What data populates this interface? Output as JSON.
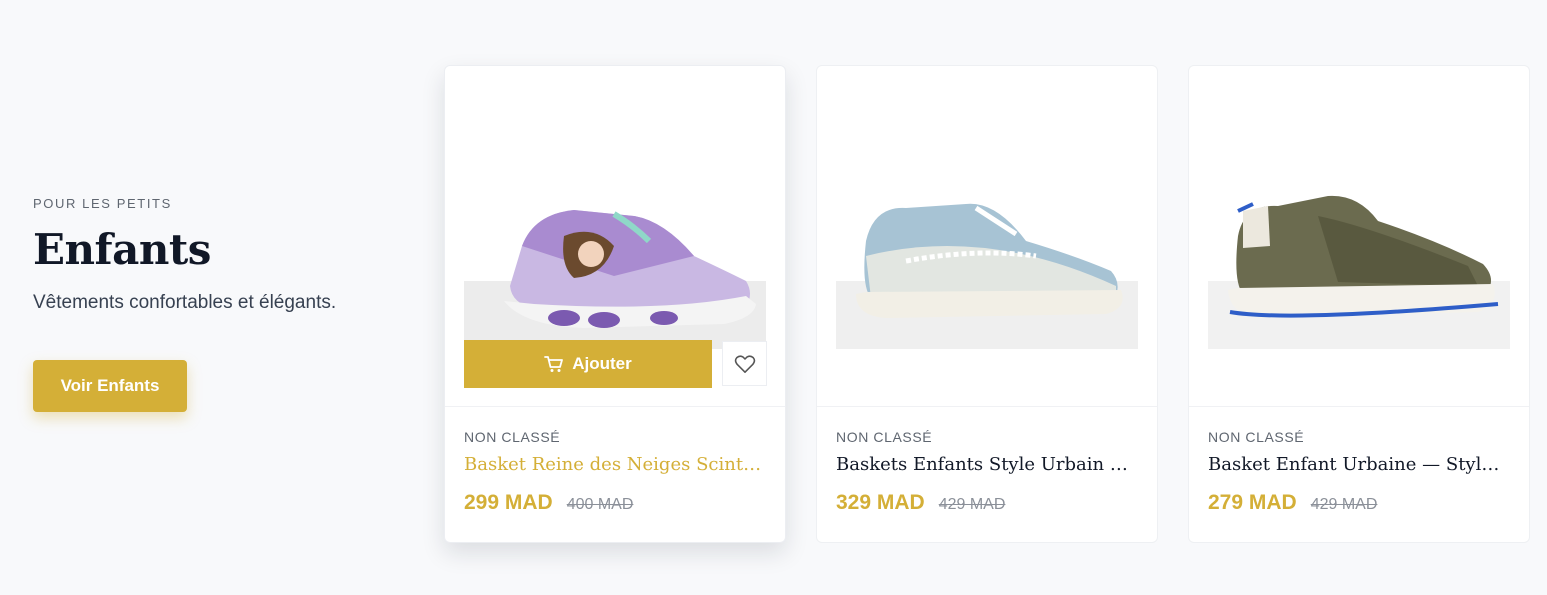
{
  "section": {
    "eyebrow": "POUR LES PETITS",
    "title": "Enfants",
    "subtitle": "Vêtements confortables et élégants.",
    "cta_label": "Voir Enfants"
  },
  "colors": {
    "accent": "#d4af37",
    "text_dark": "#111827",
    "muted": "#5f6670"
  },
  "products": [
    {
      "category": "NON CLASSÉ",
      "name": "Basket Reine des Neiges Scintillantes Enfants",
      "price": "299 MAD",
      "old_price": "400 MAD",
      "add_label": "Ajouter"
    },
    {
      "category": "NON CLASSÉ",
      "name": "Baskets Enfants Style Urbain — Confort",
      "price": "329 MAD",
      "old_price": "429 MAD"
    },
    {
      "category": "NON CLASSÉ",
      "name": "Basket Enfant Urbaine — Style & Confort",
      "price": "279 MAD",
      "old_price": "429 MAD"
    }
  ],
  "icons": {
    "cart": "cart-icon",
    "wishlist": "heart-icon"
  }
}
